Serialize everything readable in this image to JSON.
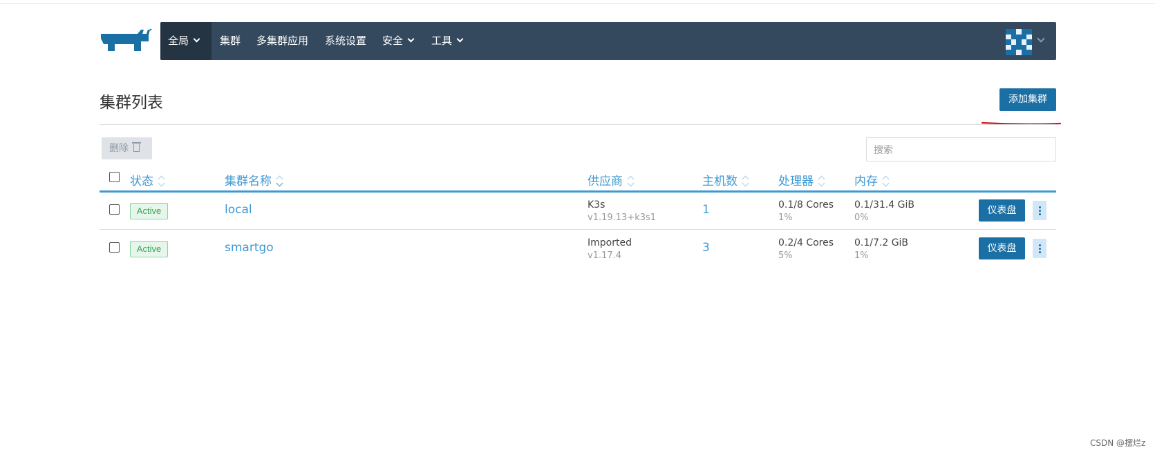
{
  "nav": {
    "global": "全局",
    "items": [
      "集群",
      "多集群应用",
      "系统设置",
      "安全",
      "工具"
    ]
  },
  "page": {
    "title": "集群列表",
    "add_button": "添加集群"
  },
  "toolbar": {
    "delete_label": "删除",
    "search_placeholder": "搜索"
  },
  "table": {
    "headers": [
      "状态",
      "集群名称",
      "供应商",
      "主机数",
      "处理器",
      "内存"
    ],
    "rows": [
      {
        "state": "Active",
        "name": "local",
        "provider": "K3s",
        "version": "v1.19.13+k3s1",
        "hosts": "1",
        "cpu": "0.1/8 Cores",
        "cpu_pct": "1%",
        "mem": "0.1/31.4 GiB",
        "mem_pct": "0%",
        "dashboard": "仪表盘"
      },
      {
        "state": "Active",
        "name": "smartgo",
        "provider": "Imported",
        "version": "v1.17.4",
        "hosts": "3",
        "cpu": "0.2/4 Cores",
        "cpu_pct": "5%",
        "mem": "0.1/7.2 GiB",
        "mem_pct": "1%",
        "dashboard": "仪表盘"
      }
    ]
  },
  "footer": "CSDN @摆烂z",
  "colors": {
    "navbar": "#34495e",
    "primary": "#1a6fa5",
    "link": "#3d98d3",
    "active_badge": "#3ba55c",
    "annotation_red": "#d9141c"
  }
}
